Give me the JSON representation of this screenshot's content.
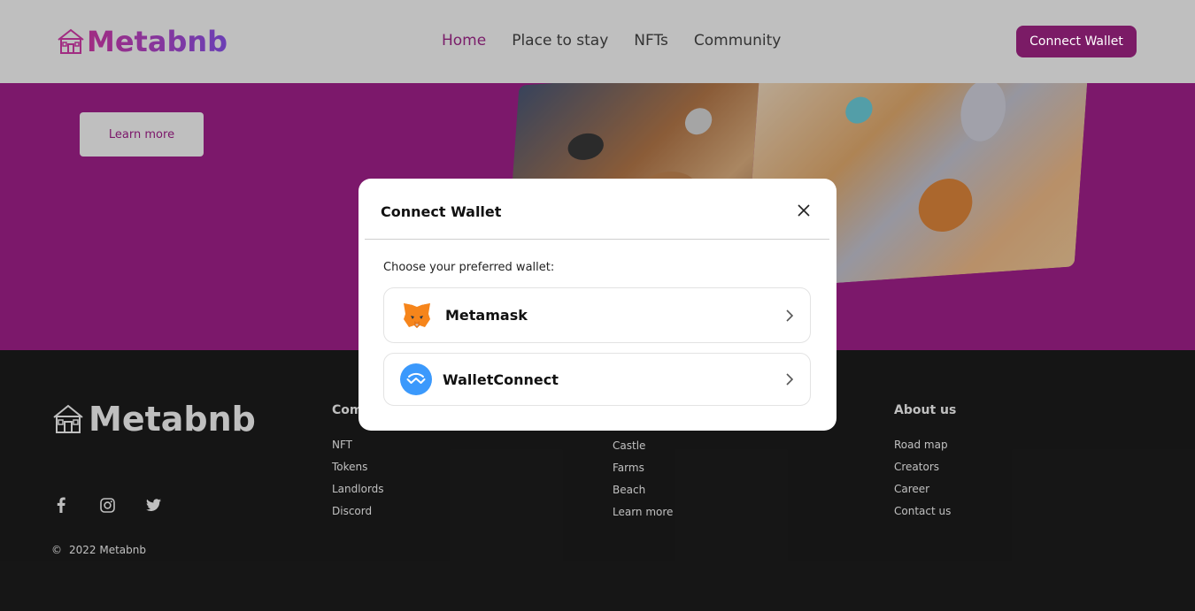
{
  "header": {
    "logo_text": "Metabnb",
    "nav": [
      {
        "label": "Home",
        "active": true
      },
      {
        "label": "Place to stay",
        "active": false
      },
      {
        "label": "NFTs",
        "active": false
      },
      {
        "label": "Community",
        "active": false
      }
    ],
    "connect_label": "Connect Wallet"
  },
  "hero": {
    "learn_more_label": "Learn more"
  },
  "modal": {
    "title": "Connect Wallet",
    "subtitle": "Choose your preferred wallet:",
    "wallets": [
      {
        "label": "Metamask",
        "icon": "metamask-fox-icon"
      },
      {
        "label": "WalletConnect",
        "icon": "walletconnect-icon"
      }
    ]
  },
  "footer": {
    "logo_text": "Metabnb",
    "columns": [
      {
        "heading": "Com",
        "links": [
          "NFT",
          "Tokens",
          "Landlords",
          "Discord"
        ]
      },
      {
        "heading": "",
        "links": [
          "Castle",
          "Farms",
          "Beach",
          "Learn more"
        ]
      },
      {
        "heading": "About us",
        "links": [
          "Road map",
          "Creators",
          "Career",
          "Contact us"
        ]
      }
    ],
    "social_icons": [
      "facebook-icon",
      "instagram-icon",
      "twitter-icon"
    ],
    "copyright_symbol": "©",
    "copyright": "2022 Metabnb"
  },
  "colors": {
    "brand": "#a6208f",
    "brand_dark": "#7b1b66",
    "header_bg": "#bfbfbf",
    "footer_bg": "#1d1d1d"
  }
}
